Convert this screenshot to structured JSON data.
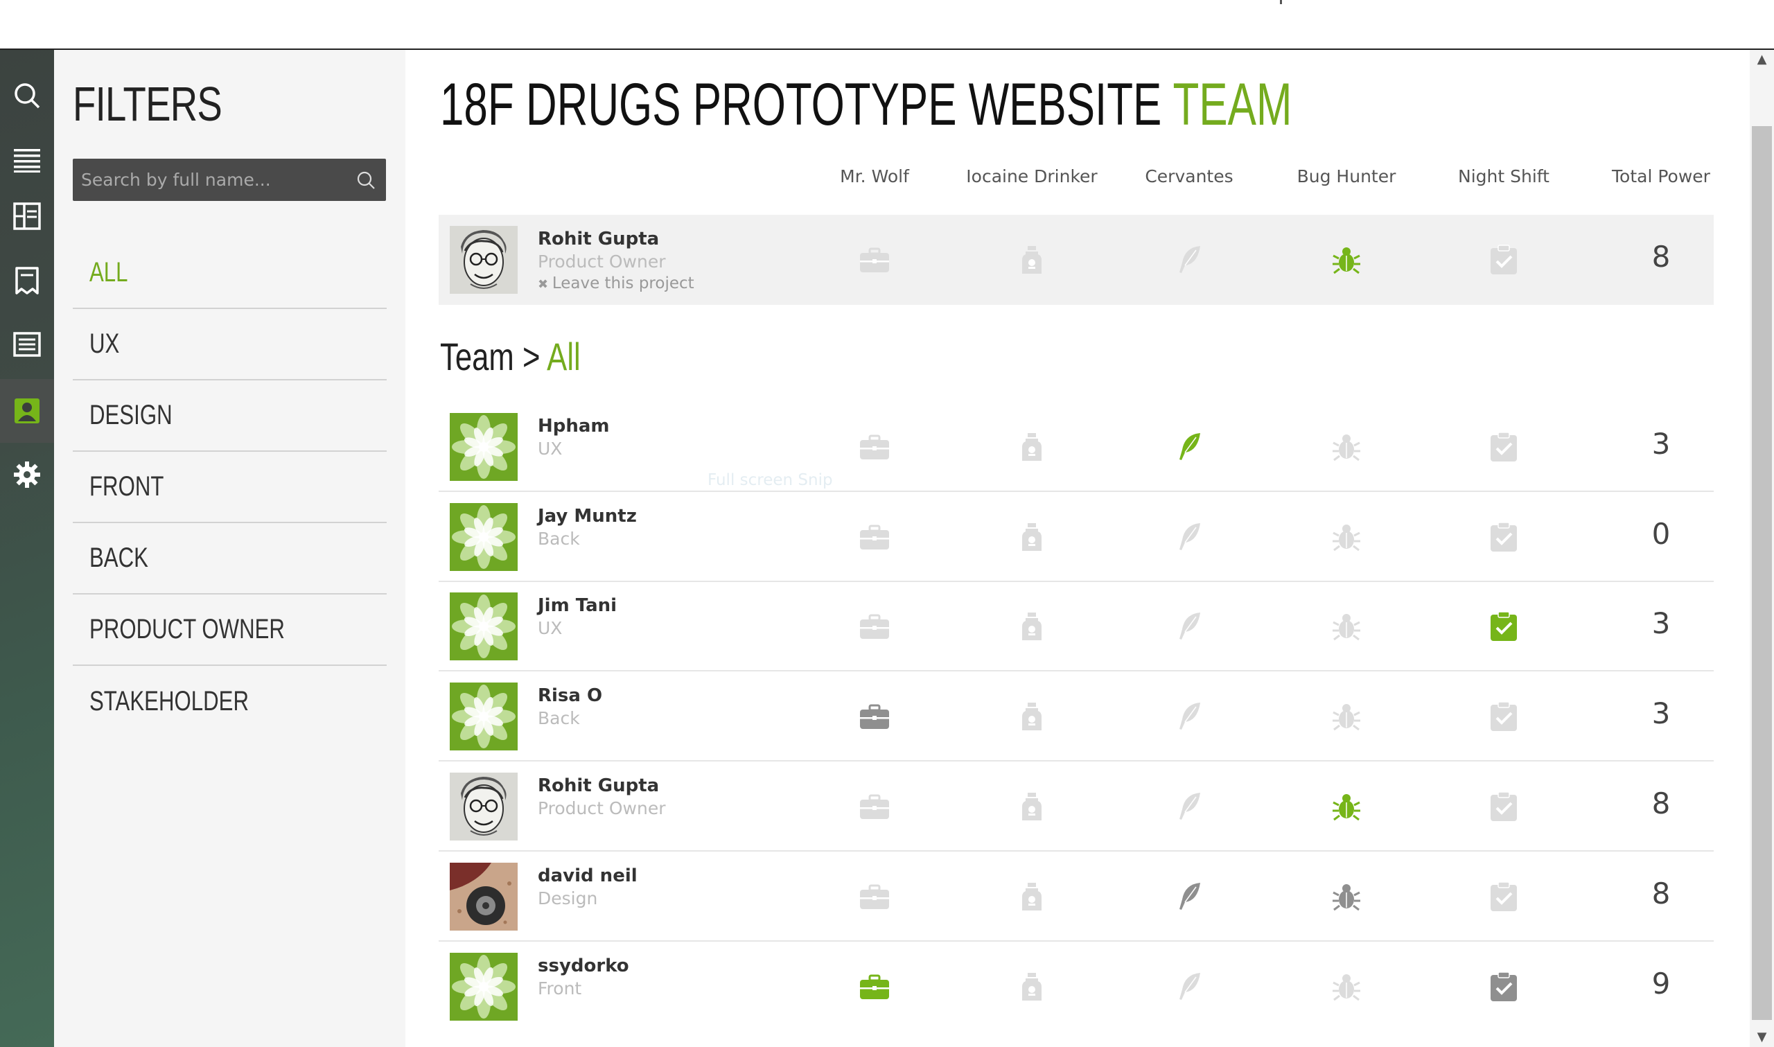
{
  "filters": {
    "title": "FILTERS",
    "search_placeholder": "Search by full name...",
    "items": [
      {
        "label": "ALL",
        "active": true
      },
      {
        "label": "UX",
        "active": false
      },
      {
        "label": "DESIGN",
        "active": false
      },
      {
        "label": "FRONT",
        "active": false
      },
      {
        "label": "BACK",
        "active": false
      },
      {
        "label": "PRODUCT OWNER",
        "active": false
      },
      {
        "label": "STAKEHOLDER",
        "active": false
      }
    ]
  },
  "page": {
    "title_main": "18F DRUGS PROTOTYPE WEBSITE",
    "title_accent": "TEAM"
  },
  "columns": [
    "Mr. Wolf",
    "Iocaine Drinker",
    "Cervantes",
    "Bug Hunter",
    "Night Shift",
    "Total Power"
  ],
  "owner": {
    "name": "Rohit Gupta",
    "role": "Product Owner",
    "leave_label": "Leave this project",
    "badges": [
      "light",
      "light",
      "light",
      "green",
      "light"
    ],
    "total": "8",
    "avatar": "caricature"
  },
  "team_heading": {
    "prefix": "Team >",
    "accent": "All"
  },
  "ghost_text": "Full screen Snip",
  "members": [
    {
      "name": "Hpham",
      "role": "UX",
      "avatar": "flower",
      "badges": [
        "light",
        "light",
        "green",
        "light",
        "light"
      ],
      "total": "3"
    },
    {
      "name": "Jay Muntz",
      "role": "Back",
      "avatar": "flower",
      "badges": [
        "light",
        "light",
        "light",
        "light",
        "light"
      ],
      "total": "0"
    },
    {
      "name": "Jim Tani",
      "role": "UX",
      "avatar": "flower",
      "badges": [
        "light",
        "light",
        "light",
        "light",
        "green"
      ],
      "total": "3"
    },
    {
      "name": "Risa O",
      "role": "Back",
      "avatar": "flower",
      "badges": [
        "gray",
        "light",
        "light",
        "light",
        "light"
      ],
      "total": "3"
    },
    {
      "name": "Rohit Gupta",
      "role": "Product Owner",
      "avatar": "caricature",
      "badges": [
        "light",
        "light",
        "light",
        "green",
        "light"
      ],
      "total": "8"
    },
    {
      "name": "david neil",
      "role": "Design",
      "avatar": "photo",
      "badges": [
        "light",
        "light",
        "gray",
        "gray",
        "light"
      ],
      "total": "8"
    },
    {
      "name": "ssydorko",
      "role": "Front",
      "avatar": "flower",
      "badges": [
        "green",
        "light",
        "light",
        "light",
        "gray"
      ],
      "total": "9"
    }
  ],
  "colors": {
    "accent": "#74ab1e",
    "badge_light": "#dcdcdc",
    "badge_gray": "#8f8f8f",
    "badge_green": "#76b519"
  },
  "rail_icons": [
    "search-icon",
    "list-icon",
    "layout-icon",
    "receipt-icon",
    "document-list-icon",
    "contact-icon",
    "gear-icon"
  ]
}
